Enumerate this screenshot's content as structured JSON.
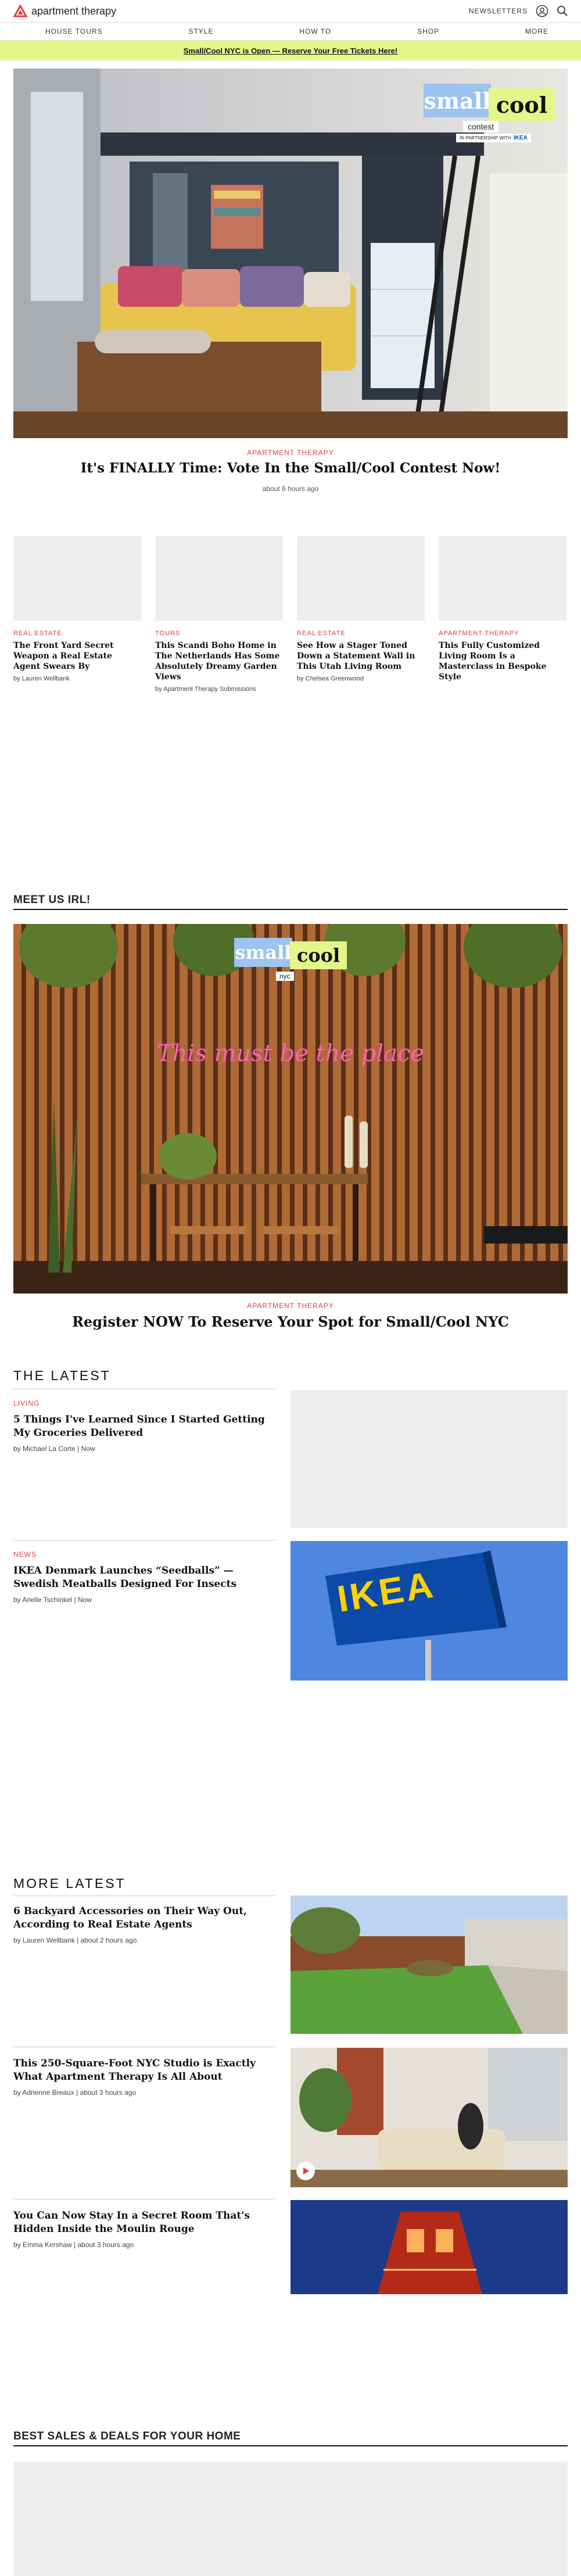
{
  "brand": {
    "name": "apartment therapy",
    "accent": "#e23a3a",
    "promo_bg": "#e4f68a"
  },
  "header": {
    "newsletters": "NEWSLETTERS",
    "icons": [
      "user-icon",
      "search-icon"
    ]
  },
  "nav": [
    "HOUSE TOURS",
    "STYLE",
    "HOW TO",
    "SHOP",
    "MORE"
  ],
  "promo": {
    "text": "Small/Cool NYC is Open — Reserve Your Free Tickets Here!"
  },
  "hero": {
    "badge": {
      "small": "small",
      "cool": "cool",
      "sub": "contest",
      "partner": "IN PARTNERSHIP WITH",
      "partner_brand": "IKEA"
    },
    "eyebrow": "APARTMENT THERAPY",
    "title": "It's FINALLY Time: Vote In the Small/Cool Contest Now!",
    "time": "about 6 hours ago"
  },
  "cards": [
    {
      "category": "REAL ESTATE",
      "title": "The Front Yard Secret Weapon a Real Estate Agent Swears By",
      "byline": "by Lauren Wellbank"
    },
    {
      "category": "TOURS",
      "title": "This Scandi Boho Home in The Netherlands Has Some Absolutely Dreamy Garden Views",
      "byline": "by Apartment Therapy Submissions"
    },
    {
      "category": "REAL ESTATE",
      "title": "See How a Stager Toned Down a Statement Wall in This Utah Living Room",
      "byline": "by Chelsea Greenwood"
    },
    {
      "category": "APARTMENT THERAPY",
      "title": "This Fully Customized Living Room Is a Masterclass in Bespoke Style",
      "byline": ""
    }
  ],
  "meet": {
    "heading": "MEET US IRL!",
    "badge": {
      "small": "small",
      "cool": "cool",
      "sub": "nyc"
    },
    "neon": "This must be the place",
    "eyebrow": "APARTMENT THERAPY",
    "title": "Register NOW To Reserve Your Spot for Small/Cool NYC"
  },
  "latest": {
    "heading": "THE LATEST",
    "items": [
      {
        "category": "LIVING",
        "title": "5 Things I've Learned Since I Started Getting My Groceries Delivered",
        "byline": "by Michael La Corte | Now"
      },
      {
        "category": "NEWS",
        "title": "IKEA Denmark Launches “Seedballs” — Swedish Meatballs Designed For Insects",
        "byline": "by Arielle Tschinkel | Now",
        "sign": "IKEA"
      }
    ]
  },
  "more": {
    "heading": "MORE LATEST",
    "items": [
      {
        "title": "6 Backyard Accessories on Their Way Out, According to Real Estate Agents",
        "byline": "by Lauren Wellbank | about 2 hours ago"
      },
      {
        "title": "This 250-Square-Foot NYC Studio is Exactly What Apartment Therapy Is All About",
        "byline": "by Adrienne Breaux | about 3 hours ago"
      },
      {
        "title": "You Can Now Stay In a Secret Room That's Hidden Inside the Moulin Rouge",
        "byline": "by Emma Kershaw | about 3 hours ago"
      }
    ]
  },
  "deals": {
    "heading": "BEST SALES & DEALS FOR YOUR HOME"
  }
}
